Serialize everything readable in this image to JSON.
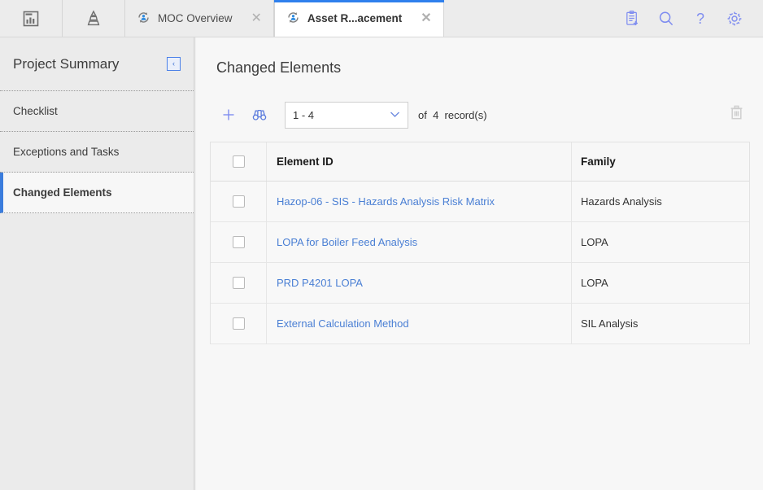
{
  "topbar": {
    "app_icons": [
      {
        "name": "dashboard-icon",
        "label": "Dashboard"
      },
      {
        "name": "hierarchy-pyramid-icon",
        "label": "Hierarchy"
      }
    ],
    "tabs": [
      {
        "label": "MOC Overview",
        "icon": "moc-refresh-person-icon",
        "close": "✕",
        "active": false
      },
      {
        "label": "Asset R...acement",
        "icon": "moc-refresh-person-icon",
        "close": "✕",
        "active": true
      }
    ],
    "actions": [
      {
        "name": "new-record-icon",
        "label": "New Record"
      },
      {
        "name": "search-icon",
        "label": "Search"
      },
      {
        "name": "help-icon",
        "label": "Help"
      },
      {
        "name": "settings-gear-icon",
        "label": "Settings"
      }
    ],
    "accent_color": "#2f80ed"
  },
  "sidebar": {
    "title": "Project Summary",
    "collapse_glyph": "‹",
    "items": [
      {
        "label": "Checklist",
        "selected": false
      },
      {
        "label": "Exceptions and Tasks",
        "selected": false
      },
      {
        "label": "Changed Elements",
        "selected": true
      }
    ],
    "selected_bar_color": "#3b7ddd"
  },
  "main": {
    "title": "Changed Elements",
    "toolbar": {
      "add_label": "+",
      "binoculars_label": "binoculars",
      "trash_label": "delete",
      "range_value": "1 - 4",
      "chevron": "⌄",
      "records_text": "of  4  record(s)"
    },
    "table": {
      "columns": [
        "",
        "Element ID",
        "Family"
      ],
      "rows": [
        {
          "element_id": "Hazop-06 - SIS - Hazards Analysis Risk Matrix",
          "family": "Hazards Analysis"
        },
        {
          "element_id": "LOPA for Boiler Feed Analysis",
          "family": "LOPA"
        },
        {
          "element_id": "PRD P4201 LOPA",
          "family": "LOPA"
        },
        {
          "element_id": "External Calculation Method",
          "family": "SIL Analysis"
        }
      ]
    },
    "link_color": "#4a7fd4"
  }
}
